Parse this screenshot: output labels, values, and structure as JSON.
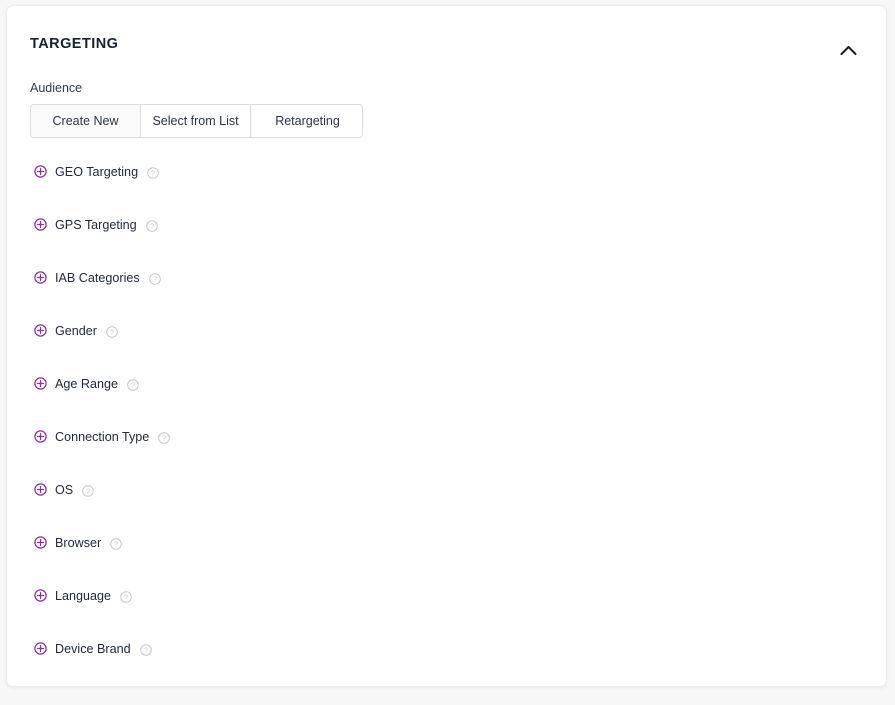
{
  "panel": {
    "title": "TARGETING",
    "collapse_icon": "chevron-up-icon"
  },
  "audience": {
    "label": "Audience",
    "options": [
      {
        "label": "Create New",
        "active": true
      },
      {
        "label": "Select from List",
        "active": false
      },
      {
        "label": "Retargeting",
        "active": false
      }
    ]
  },
  "targeting_options": [
    {
      "label": "GEO Targeting",
      "expand_icon": "circle-plus-icon",
      "help_icon": "question-circle-icon"
    },
    {
      "label": "GPS Targeting",
      "expand_icon": "circle-plus-icon",
      "help_icon": "question-circle-icon"
    },
    {
      "label": "IAB Categories",
      "expand_icon": "circle-plus-icon",
      "help_icon": "question-circle-icon"
    },
    {
      "label": "Gender",
      "expand_icon": "circle-plus-icon",
      "help_icon": "question-circle-icon"
    },
    {
      "label": "Age Range",
      "expand_icon": "circle-plus-icon",
      "help_icon": "question-circle-icon"
    },
    {
      "label": "Connection Type",
      "expand_icon": "circle-plus-icon",
      "help_icon": "question-circle-icon"
    },
    {
      "label": "OS",
      "expand_icon": "circle-plus-icon",
      "help_icon": "question-circle-icon"
    },
    {
      "label": "Browser",
      "expand_icon": "circle-plus-icon",
      "help_icon": "question-circle-icon"
    },
    {
      "label": "Language",
      "expand_icon": "circle-plus-icon",
      "help_icon": "question-circle-icon"
    },
    {
      "label": "Device Brand",
      "expand_icon": "circle-plus-icon",
      "help_icon": "question-circle-icon"
    }
  ],
  "colors": {
    "accent_purple": "#8e2f9e",
    "help_grey": "#c3c6cf",
    "title_dark": "#1b2236",
    "card_bg": "#ffffff",
    "page_bg": "#f7f7f8",
    "border": "#dcdce2"
  }
}
